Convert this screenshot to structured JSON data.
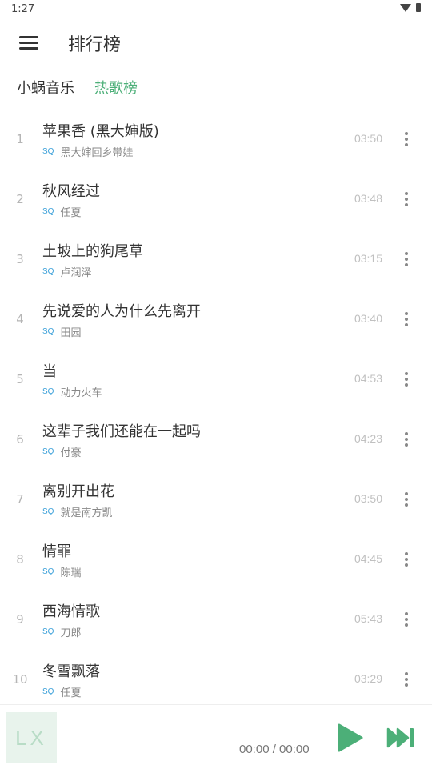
{
  "status_bar": {
    "time": "1:27"
  },
  "header": {
    "title": "排行榜"
  },
  "tabs": {
    "source": "小蜗音乐",
    "board": "热歌榜"
  },
  "songs": [
    {
      "index": "1",
      "title": "苹果香 (黑大婶版)",
      "quality": "SQ",
      "artist": "黑大婶回乡带娃",
      "duration": "03:50"
    },
    {
      "index": "2",
      "title": "秋风经过",
      "quality": "SQ",
      "artist": "任夏",
      "duration": "03:48"
    },
    {
      "index": "3",
      "title": "土坡上的狗尾草",
      "quality": "SQ",
      "artist": "卢润泽",
      "duration": "03:15"
    },
    {
      "index": "4",
      "title": "先说爱的人为什么先离开",
      "quality": "SQ",
      "artist": "田园",
      "duration": "03:40"
    },
    {
      "index": "5",
      "title": "当",
      "quality": "SQ",
      "artist": "动力火车",
      "duration": "04:53"
    },
    {
      "index": "6",
      "title": "这辈子我们还能在一起吗",
      "quality": "SQ",
      "artist": "付豪",
      "duration": "04:23"
    },
    {
      "index": "7",
      "title": "离别开出花",
      "quality": "SQ",
      "artist": "就是南方凯",
      "duration": "03:50"
    },
    {
      "index": "8",
      "title": "情罪",
      "quality": "SQ",
      "artist": "陈瑞",
      "duration": "04:45"
    },
    {
      "index": "9",
      "title": "西海情歌",
      "quality": "SQ",
      "artist": "刀郎",
      "duration": "05:43"
    },
    {
      "index": "10",
      "title": "冬雪飘落",
      "quality": "SQ",
      "artist": "任夏",
      "duration": "03:29"
    }
  ],
  "player": {
    "cover_text": "LX",
    "time": "00:00 / 00:00"
  },
  "colors": {
    "accent": "#4caf78",
    "quality_badge": "#3ba0d9",
    "play_button": "#4caf78"
  },
  "icons": {
    "menu": "hamburger-menu-icon",
    "more": "more-vertical-icon",
    "play": "play-icon",
    "next": "skip-next-icon",
    "wifi": "wifi-icon",
    "battery": "battery-icon"
  }
}
